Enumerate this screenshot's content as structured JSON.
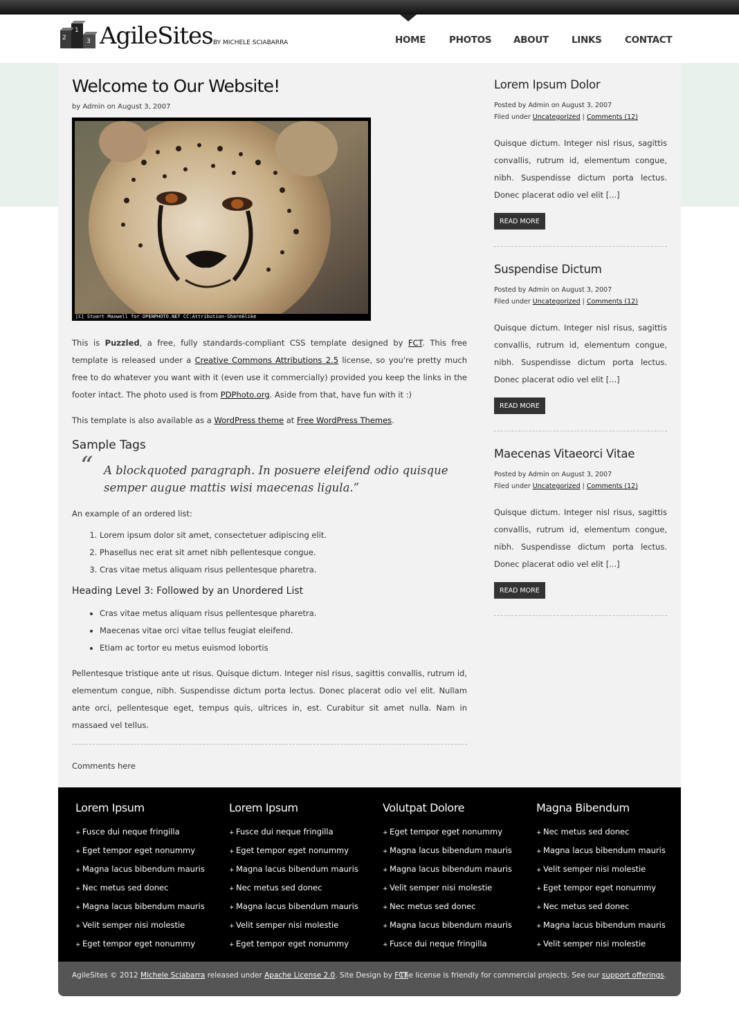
{
  "site": {
    "title": "AgileSites",
    "byline": "BY MICHELE SCIABARRA",
    "podium_numbers": [
      "1",
      "2",
      "3"
    ]
  },
  "nav": {
    "items": [
      "HOME",
      "PHOTOS",
      "ABOUT",
      "LINKS",
      "CONTACT"
    ],
    "active": "HOME"
  },
  "post": {
    "title": "Welcome to Our Website!",
    "byline": "by Admin on August 3, 2007",
    "photo_credit": "[C] Stuart Maxwell for OPENPHOTO.NET CC:Attribution-ShareAlike",
    "p1": {
      "t1": "This is ",
      "bold": "Puzzled",
      "t2": ", a free, fully standards-compliant CSS template designed by ",
      "link1": "FCT",
      "t3": ". This free template is released under a ",
      "link2": "Creative Commons Attributions 2.5",
      "t4": " license, so you're pretty much free to do whatever you want with it (even use it commercially) provided you keep the links in the footer intact. The photo used is from ",
      "link3": "PDPhoto.org",
      "t5": ". Aside from that, have fun with it :)"
    },
    "p2": {
      "t1": "This template is also available as a ",
      "link1": "WordPress theme",
      "t2": " at ",
      "link2": "Free WordPress Themes",
      "t3": "."
    },
    "sample_heading": "Sample Tags",
    "quote_mark": "“",
    "quote": "A blockquoted paragraph. In posuere eleifend odio quisque semper augue mattis wisi maecenas ligula.”",
    "ol_intro": "An example of an ordered list:",
    "ol": [
      "Lorem ipsum dolor sit amet, consectetuer adipiscing elit.",
      "Phasellus nec erat sit amet nibh pellentesque congue.",
      "Cras vitae metus aliquam risus pellentesque pharetra."
    ],
    "h3": "Heading Level 3: Followed by an Unordered List",
    "ul": [
      "Cras vitae metus aliquam risus pellentesque pharetra.",
      "Maecenas vitae orci vitae tellus feugiat eleifend.",
      "Etiam ac tortor eu metus euismod lobortis"
    ],
    "p3": "Pellentesque tristique ante ut risus. Quisque dictum. Integer nisl risus, sagittis convallis, rutrum id, elementum congue, nibh. Suspendisse dictum porta lectus. Donec placerat odio vel elit. Nullam ante orci, pellentesque eget, tempus quis, ultrices in, est. Curabitur sit amet nulla. Nam in massaed vel tellus.",
    "comments": "Comments here"
  },
  "sidebar": {
    "posts": [
      {
        "title": "Lorem Ipsum Dolor",
        "posted": "Posted by Admin on August 3, 2007",
        "filed_prefix": "Filed under ",
        "category": "Uncategorized",
        "sep": " | ",
        "comments": "Comments (12)",
        "text": "Quisque dictum. Integer nisl risus, sagittis convallis, rutrum id, elementum congue, nibh. Suspendisse dictum porta lectus. Donec placerat odio vel elit [...]",
        "button": "READ MORE"
      },
      {
        "title": "Suspendise Dictum",
        "posted": "Posted by Admin on August 3, 2007",
        "filed_prefix": "Filed under ",
        "category": "Uncategorized",
        "sep": " | ",
        "comments": "Comments (12)",
        "text": "Quisque dictum. Integer nisl risus, sagittis convallis, rutrum id, elementum congue, nibh. Suspendisse dictum porta lectus. Donec placerat odio vel elit [...]",
        "button": "READ MORE"
      },
      {
        "title": "Maecenas Vitaeorci Vitae",
        "posted": "Posted by Admin on August 3, 2007",
        "filed_prefix": "Filed under ",
        "category": "Uncategorized",
        "sep": " | ",
        "comments": "Comments (12)",
        "text": "Quisque dictum. Integer nisl risus, sagittis convallis, rutrum id, elementum congue, nibh. Suspendisse dictum porta lectus. Donec placerat odio vel elit [...]",
        "button": "READ MORE"
      }
    ]
  },
  "footer": {
    "bullet": "+",
    "columns": [
      {
        "heading": "Lorem Ipsum",
        "items": [
          "Fusce dui neque fringilla",
          "Eget tempor eget nonummy",
          "Magna lacus bibendum mauris",
          "Nec metus sed donec",
          "Magna lacus bibendum mauris",
          "Velit semper nisi molestie",
          "Eget tempor eget nonummy"
        ]
      },
      {
        "heading": "Lorem Ipsum",
        "items": [
          "Fusce dui neque fringilla",
          "Eget tempor eget nonummy",
          "Magna lacus bibendum mauris",
          "Nec metus sed donec",
          "Magna lacus bibendum mauris",
          "Velit semper nisi molestie",
          "Eget tempor eget nonummy"
        ]
      },
      {
        "heading": "Volutpat Dolore",
        "items": [
          "Eget tempor eget nonummy",
          "Magna lacus bibendum mauris",
          "Magna lacus bibendum mauris",
          "Velit semper nisi molestie",
          "Nec metus sed donec",
          "Magna lacus bibendum mauris",
          "Fusce dui neque fringilla"
        ]
      },
      {
        "heading": "Magna Bibendum",
        "items": [
          "Nec metus sed donec",
          "Magna lacus bibendum mauris",
          "Velit semper nisi molestie",
          "Eget tempor eget nonummy",
          "Nec metus sed donec",
          "Magna lacus bibendum mauris",
          "Velit semper nisi molestie"
        ]
      }
    ],
    "bar": {
      "left_t1": "AgileSites © 2012 ",
      "left_link1": "Michele Sciabarra",
      "left_t2": " released under ",
      "left_link2": "Apache License 2.0",
      "left_t3": ". Site Design by ",
      "left_link3": "FCT",
      "right_t1": "The license is friendly for commercial projects. See our ",
      "right_link": "support offerings",
      "right_t2": "."
    }
  },
  "colors": {
    "band": "#e9f1ec",
    "panel": "#f2f2f2",
    "footer_bg": "#000000",
    "footer_bar": "#555555",
    "button": "#333333"
  }
}
